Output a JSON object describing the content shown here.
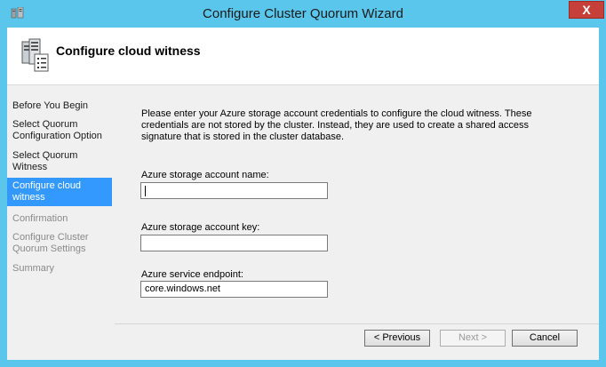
{
  "window": {
    "title": "Configure Cluster Quorum Wizard",
    "close_glyph": "X"
  },
  "header": {
    "title": "Configure cloud witness",
    "icon": "cluster-server-icon"
  },
  "nav": {
    "items": [
      {
        "label": "Before You Begin",
        "state": "normal"
      },
      {
        "label": "Select Quorum Configuration Option",
        "state": "normal"
      },
      {
        "label": "Select Quorum Witness",
        "state": "normal"
      },
      {
        "label": "Configure cloud witness",
        "state": "active"
      },
      {
        "label": "Confirmation",
        "state": "disabled"
      },
      {
        "label": "Configure Cluster Quorum Settings",
        "state": "disabled"
      },
      {
        "label": "Summary",
        "state": "disabled"
      }
    ]
  },
  "main": {
    "intro": "Please enter your Azure storage account credentials to configure the cloud witness. These credentials are not stored by the cluster. Instead, they are used to create a shared access signature that is stored in the cluster database.",
    "account_name": {
      "label": "Azure storage account name:",
      "value": ""
    },
    "account_key": {
      "label": "Azure storage account key:",
      "value": ""
    },
    "endpoint": {
      "label": "Azure service endpoint:",
      "value": "core.windows.net"
    }
  },
  "buttons": {
    "previous": "< Previous",
    "next": "Next >",
    "cancel": "Cancel"
  },
  "colors": {
    "accent": "#3399ff",
    "frame": "#5bc6ec",
    "close": "#c6403a"
  }
}
